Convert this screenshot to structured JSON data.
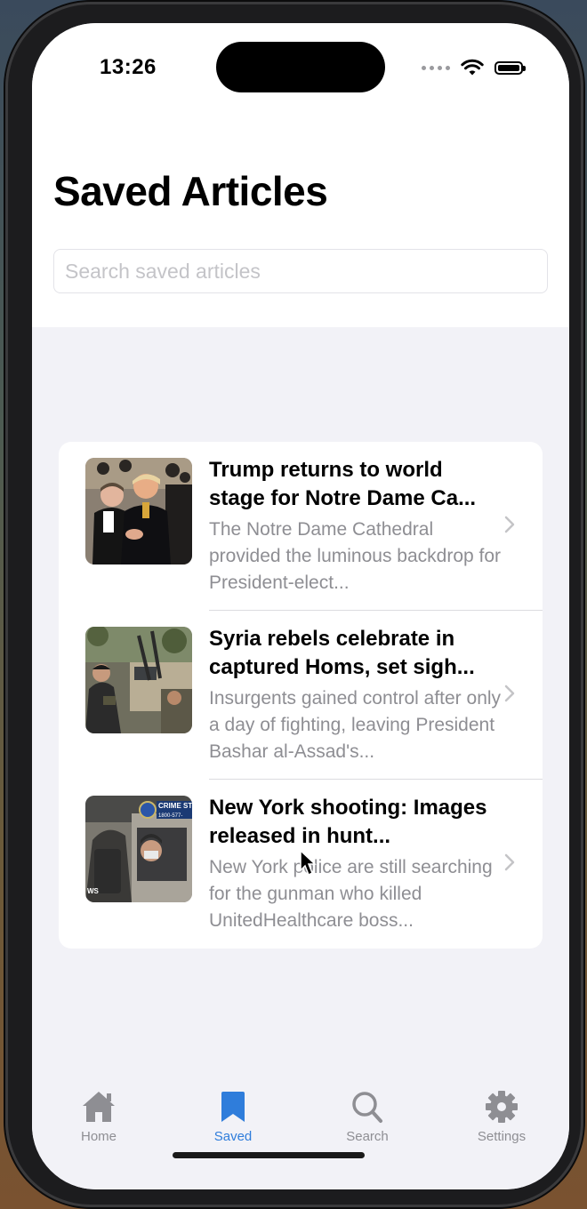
{
  "status_bar": {
    "time": "13:26"
  },
  "header": {
    "title": "Saved Articles",
    "search_placeholder": "Search saved articles",
    "search_value": ""
  },
  "articles": [
    {
      "title": "Trump returns to world stage for Notre Dame Ca...",
      "description": "The Notre Dame Cathedral provided the luminous backdrop for President-elect...",
      "thumbnail": "photo-two-men-handshake"
    },
    {
      "title": "Syria rebels celebrate in captured Homs, set sigh...",
      "description": "Insurgents gained control after only a day of fighting, leaving President Bashar al-Assad's...",
      "thumbnail": "photo-armed-fighters-vehicle"
    },
    {
      "title": "New York shooting: Images released in hunt...",
      "description": "New York police are still searching for the gunman who killed UnitedHealthcare boss...",
      "thumbnail": "photo-cctv-suspect-taxi",
      "thumbnail_text": {
        "crime": "CRIME ST",
        "phone": "1800-577-",
        "ws": "WS"
      }
    }
  ],
  "tab_bar": {
    "tabs": [
      {
        "label": "Home",
        "icon": "house-icon",
        "active": false
      },
      {
        "label": "Saved",
        "icon": "bookmark-icon",
        "active": true
      },
      {
        "label": "Search",
        "icon": "magnifier-icon",
        "active": false
      },
      {
        "label": "Settings",
        "icon": "gear-icon",
        "active": false
      }
    ]
  },
  "colors": {
    "accent": "#2f7ddb",
    "inactive_tab": "#8e8e93",
    "secondary_text": "#8e8e93",
    "background": "#f2f2f7"
  }
}
